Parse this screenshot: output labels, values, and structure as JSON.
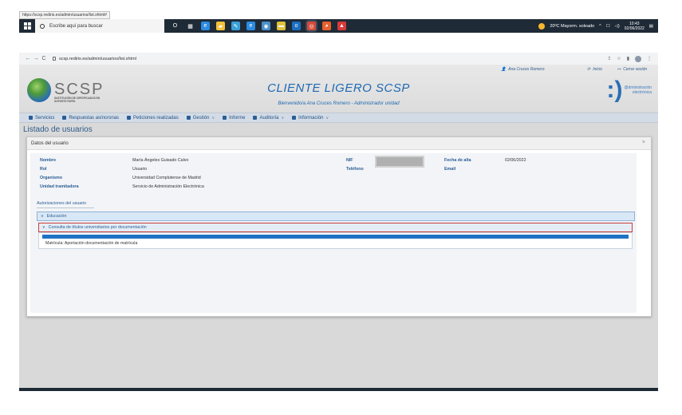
{
  "tooltip_url": "https://scsp.rediris.es/admin/usuarios/list.xhtml#",
  "taskbar": {
    "search_placeholder": "Escribe aquí para buscar",
    "weather": "20ºC  Mayorm. soleado",
    "time": "10:43",
    "date": "02/06/2022",
    "apps": [
      {
        "icon": "task-view-icon",
        "color": "#1f2a37",
        "glyph": "O"
      },
      {
        "icon": "widgets-icon",
        "color": "#1f2a37",
        "glyph": "▦"
      },
      {
        "icon": "edge-icon",
        "color": "#2b8be0",
        "glyph": "e"
      },
      {
        "icon": "file-explorer-icon",
        "color": "#f3c13a",
        "glyph": "▰"
      },
      {
        "icon": "feather-icon",
        "color": "#3aa0d8",
        "glyph": "✎"
      },
      {
        "icon": "ie-icon",
        "color": "#2b8be0",
        "glyph": "e"
      },
      {
        "icon": "chrome-alt-icon",
        "color": "#4a90c8",
        "glyph": "◉"
      },
      {
        "icon": "sticky-notes-icon",
        "color": "#e0c23a",
        "glyph": "▬"
      },
      {
        "icon": "outlook-icon",
        "color": "#1b6ec2",
        "glyph": "o"
      },
      {
        "icon": "chrome-icon",
        "color": "#d44a3a",
        "glyph": "◎"
      },
      {
        "icon": "firefox-icon",
        "color": "#e8602c",
        "glyph": "◕"
      },
      {
        "icon": "pdf-icon",
        "color": "#d83a3a",
        "glyph": "▲"
      }
    ]
  },
  "browser": {
    "address": "scsp.rediris.es/admin/usuarios/list.xhtml",
    "profile_initial": "A"
  },
  "header": {
    "user": "Ana Cruces Romero",
    "inicio": "Inicio",
    "cerrar": "Cerrar sesión",
    "logo_text": "SCSP",
    "logo_sub": "SUSTITUCIÓN DE CERTIFICADOS EN SOPORTE PAPEL",
    "title": "CLIENTE LIGERO SCSP",
    "subtitle": "Bienvenido/a Ana Cruces Romero - Administrador unidad",
    "ae_line1": "@dministración",
    "ae_line2": "electrónica"
  },
  "menu": [
    {
      "label": "Servicios",
      "dropdown": false,
      "icon": "list-icon"
    },
    {
      "label": "Respuestas asíncronas",
      "dropdown": false,
      "icon": "gear-icon"
    },
    {
      "label": "Peticiones realizadas",
      "dropdown": false,
      "icon": "search-icon"
    },
    {
      "label": "Gestión",
      "dropdown": true,
      "icon": "plus-icon"
    },
    {
      "label": "Informe",
      "dropdown": false,
      "icon": "document-icon"
    },
    {
      "label": "Auditoría",
      "dropdown": true,
      "icon": "user-icon"
    },
    {
      "label": "Información",
      "dropdown": true,
      "icon": "info-icon"
    }
  ],
  "page_title": "Listado de usuarios",
  "panel": {
    "title": "Datos del usuario",
    "fields_left": [
      {
        "label": "Nombre",
        "value": "María Ángeles Guisado Calvo"
      },
      {
        "label": "Rol",
        "value": "Usuario"
      },
      {
        "label": "Organismo",
        "value": "Universidad Complutense de Madrid"
      },
      {
        "label": "Unidad tramitadora",
        "value": "Servicio de Administración Electrónica"
      }
    ],
    "nif_label": "NIF",
    "telefono_label": "Teléfono",
    "fecha_label": "Fecha de alta",
    "fecha_value": "02/06/2022",
    "email_label": "Email",
    "auth_tab": "Autorizaciones del usuario",
    "acc_level1": "Educación",
    "acc_level2": "Consulta de títulos universitarios por documentación",
    "acc_item": "Matrícula: Aportación documentación de matrícula"
  }
}
